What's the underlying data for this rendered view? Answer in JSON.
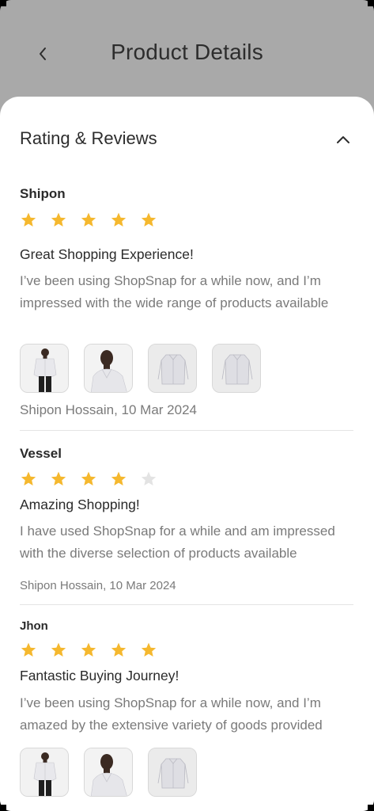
{
  "header": {
    "title": "Product Details",
    "back_icon": "chevron-left-icon"
  },
  "section": {
    "title": "Rating & Reviews",
    "toggle_icon": "chevron-up-icon"
  },
  "colors": {
    "star_filled": "#F5B82E",
    "star_empty": "#E3E3E3",
    "overlay": "#A9A9A9"
  },
  "reviews": [
    {
      "name": "Shipon",
      "rating": 5,
      "title": "Great Shopping Experience!",
      "body": "I’ve been using ShopSnap for a while now, and I’m impressed with the wide range of products available",
      "photos": [
        "man-in-white-shirt-photo",
        "man-in-shirt-portrait-photo",
        "white-shirt-photo",
        "white-shirt-photo"
      ],
      "meta": "Shipon Hossain, 10 Mar 2024"
    },
    {
      "name": "Vessel",
      "rating": 4,
      "title": "Amazing Shopping!",
      "body": "I have used ShopSnap for a while and am impressed with the diverse selection of products available",
      "photos": [],
      "meta": "Shipon Hossain, 10 Mar 2024"
    },
    {
      "name": "Jhon",
      "rating": 5,
      "title": "Fantastic Buying Journey!",
      "body": "I’ve been using ShopSnap for a while now, and I’m amazed by the extensive variety of goods provided",
      "photos": [
        "man-in-white-shirt-photo",
        "man-in-shirt-portrait-photo",
        "white-shirt-photo"
      ],
      "meta": ""
    }
  ]
}
